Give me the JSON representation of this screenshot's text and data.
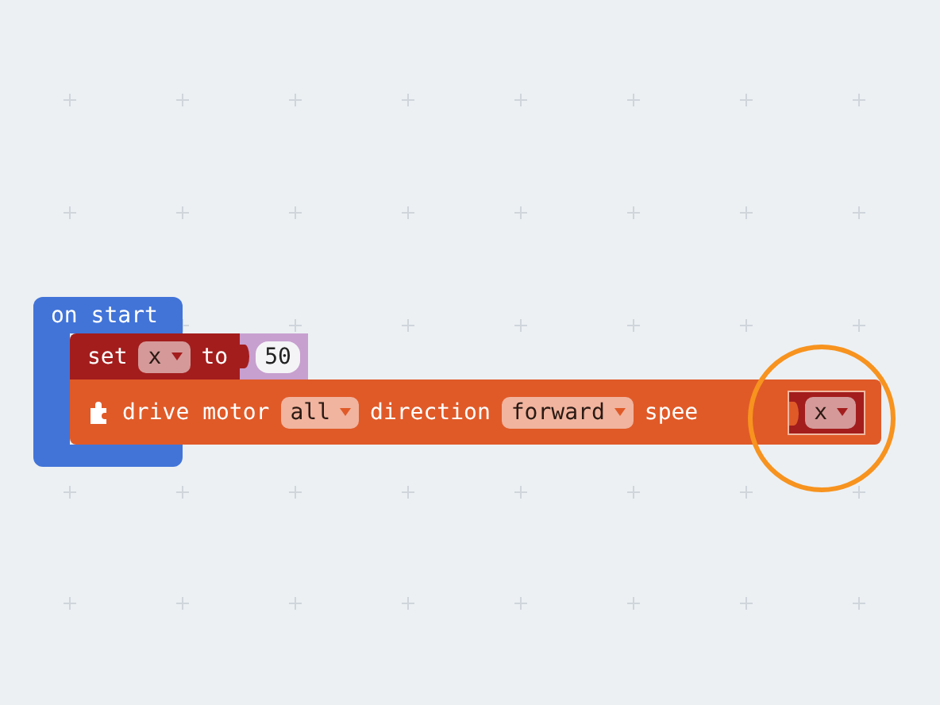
{
  "event_block": {
    "label": "on start"
  },
  "statements": [
    {
      "kind": "set",
      "parts": [
        {
          "kind": "text",
          "text": "set"
        },
        {
          "kind": "dropdown",
          "text": "x"
        },
        {
          "kind": "text",
          "text": "to"
        },
        {
          "kind": "number",
          "text": "50"
        }
      ]
    },
    {
      "kind": "motor",
      "parts": [
        {
          "kind": "text",
          "text": "drive motor"
        },
        {
          "kind": "dropdown",
          "text": "all"
        },
        {
          "kind": "text",
          "text": "direction"
        },
        {
          "kind": "dropdown",
          "text": "forward"
        },
        {
          "kind": "text",
          "text": "spee"
        },
        {
          "kind": "variable",
          "text": "x",
          "highlighted": true
        }
      ]
    }
  ]
}
